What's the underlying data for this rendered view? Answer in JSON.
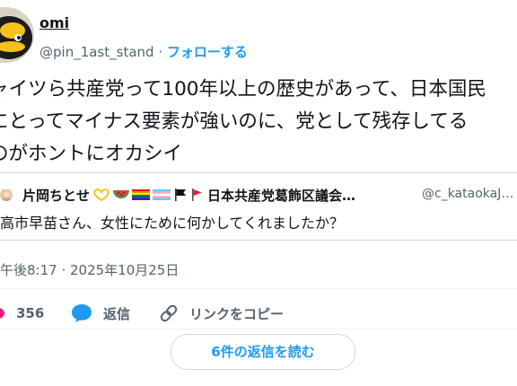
{
  "author": {
    "name": "omi",
    "handle": "@pin_1ast_stand",
    "separator": " · ",
    "follow_label": "フォローする"
  },
  "tweet": {
    "lines": [
      "ャイツら共産党って100年以上の歴史があって、日本国民",
      "にとってマイナス要素が強いのに、党として残存してる",
      "のがホントにオカシイ"
    ]
  },
  "quote": {
    "name": "片岡ちとせ",
    "name_suffix": "日本共産党葛飾区議会…",
    "handle": "@c_kataokaJ…",
    "text": "高市早苗さん、女性にために何かしてくれましたか？"
  },
  "timestamp": "午後8:17 · 2025年10月25日",
  "actions": {
    "like_count": "356",
    "reply_label": "返信",
    "copy_link_label": "リンクをコピー"
  },
  "read_replies_label": "6件の返信を読む",
  "colors": {
    "accent": "#1d9bf0",
    "like": "#f91880",
    "secondary_text": "#536471",
    "border": "#cfd9de"
  }
}
